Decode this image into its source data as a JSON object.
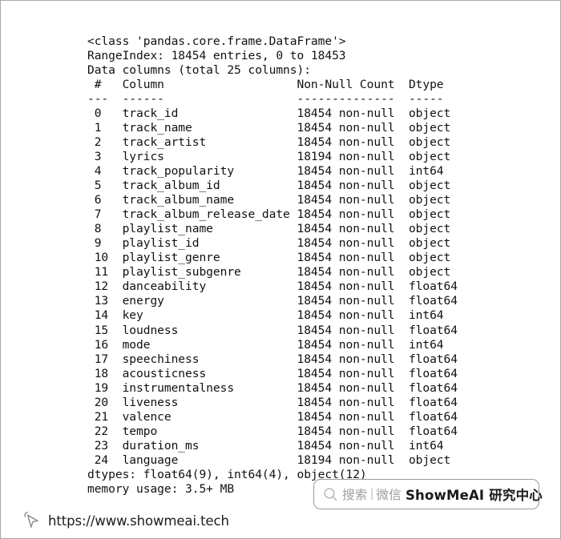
{
  "console": {
    "class_line": "<class 'pandas.core.frame.DataFrame'>",
    "range_index_line": "RangeIndex: 18454 entries, 0 to 18453",
    "data_columns_line": "Data columns (total 25 columns):",
    "header": {
      "index_label": "#",
      "column_label": "Column",
      "non_null_label": "Non-Null Count",
      "dtype_label": "Dtype"
    },
    "separator": {
      "index_rule": "---",
      "column_rule": "------",
      "non_null_rule": "--------------",
      "dtype_rule": "-----"
    },
    "rows": [
      {
        "index": "0",
        "name": "track_id",
        "non_null": "18454 non-null",
        "dtype": "object"
      },
      {
        "index": "1",
        "name": "track_name",
        "non_null": "18454 non-null",
        "dtype": "object"
      },
      {
        "index": "2",
        "name": "track_artist",
        "non_null": "18454 non-null",
        "dtype": "object"
      },
      {
        "index": "3",
        "name": "lyrics",
        "non_null": "18194 non-null",
        "dtype": "object"
      },
      {
        "index": "4",
        "name": "track_popularity",
        "non_null": "18454 non-null",
        "dtype": "int64"
      },
      {
        "index": "5",
        "name": "track_album_id",
        "non_null": "18454 non-null",
        "dtype": "object"
      },
      {
        "index": "6",
        "name": "track_album_name",
        "non_null": "18454 non-null",
        "dtype": "object"
      },
      {
        "index": "7",
        "name": "track_album_release_date",
        "non_null": "18454 non-null",
        "dtype": "object"
      },
      {
        "index": "8",
        "name": "playlist_name",
        "non_null": "18454 non-null",
        "dtype": "object"
      },
      {
        "index": "9",
        "name": "playlist_id",
        "non_null": "18454 non-null",
        "dtype": "object"
      },
      {
        "index": "10",
        "name": "playlist_genre",
        "non_null": "18454 non-null",
        "dtype": "object"
      },
      {
        "index": "11",
        "name": "playlist_subgenre",
        "non_null": "18454 non-null",
        "dtype": "object"
      },
      {
        "index": "12",
        "name": "danceability",
        "non_null": "18454 non-null",
        "dtype": "float64"
      },
      {
        "index": "13",
        "name": "energy",
        "non_null": "18454 non-null",
        "dtype": "float64"
      },
      {
        "index": "14",
        "name": "key",
        "non_null": "18454 non-null",
        "dtype": "int64"
      },
      {
        "index": "15",
        "name": "loudness",
        "non_null": "18454 non-null",
        "dtype": "float64"
      },
      {
        "index": "16",
        "name": "mode",
        "non_null": "18454 non-null",
        "dtype": "int64"
      },
      {
        "index": "17",
        "name": "speechiness",
        "non_null": "18454 non-null",
        "dtype": "float64"
      },
      {
        "index": "18",
        "name": "acousticness",
        "non_null": "18454 non-null",
        "dtype": "float64"
      },
      {
        "index": "19",
        "name": "instrumentalness",
        "non_null": "18454 non-null",
        "dtype": "float64"
      },
      {
        "index": "20",
        "name": "liveness",
        "non_null": "18454 non-null",
        "dtype": "float64"
      },
      {
        "index": "21",
        "name": "valence",
        "non_null": "18454 non-null",
        "dtype": "float64"
      },
      {
        "index": "22",
        "name": "tempo",
        "non_null": "18454 non-null",
        "dtype": "float64"
      },
      {
        "index": "23",
        "name": "duration_ms",
        "non_null": "18454 non-null",
        "dtype": "int64"
      },
      {
        "index": "24",
        "name": "language",
        "non_null": "18194 non-null",
        "dtype": "object"
      }
    ],
    "dtypes_line": "dtypes: float64(9), int64(4), object(12)",
    "memory_usage_line": "memory usage: 3.5+ MB"
  },
  "watermark": {
    "search_icon": "search-icon",
    "search_label": "搜索",
    "divider": "|",
    "channel_label": "微信",
    "brand_label": "ShowMeAI 研究中心"
  },
  "footer": {
    "cursor_icon": "cursor-pointer-icon",
    "url": "https://www.showmeai.tech"
  },
  "colors": {
    "background": "#ffffff",
    "text": "#111111",
    "border": "#a8a8a8",
    "watermark_gray": "#9d9d9d",
    "brand_dark": "#1a1a1a"
  }
}
